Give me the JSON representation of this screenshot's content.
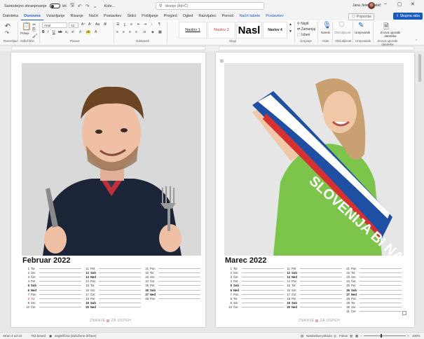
{
  "titlebar": {
    "autosave_label": "Samodejno shranjevanje",
    "autosave_state": "Izk",
    "doc_title": "Kole...",
    "search_placeholder": "Iskanje (Alt+Č)",
    "user_name": "Jana Jelenc Babič",
    "icons": [
      "save-icon",
      "undo-icon",
      "redo-icon"
    ]
  },
  "tabs": [
    "Datoteka",
    "Osnovno",
    "Vstavljanje",
    "Risanje",
    "Načrt",
    "Postavitev",
    "Sklici",
    "Pošiljanje",
    "Pregled",
    "Ogled",
    "Razvijalec",
    "Pomoč",
    "Načrt tabele",
    "Postavitev"
  ],
  "active_tab": "Osnovno",
  "contextual_tabs": [
    "Načrt tabele",
    "Postavitev"
  ],
  "comments_label": "Pripombe",
  "share_label": "Skupna raba",
  "ribbon": {
    "groups": [
      "Razveljavi",
      "Odložišče",
      "Pisava",
      "Odstavek",
      "Slogi",
      "Urejanje",
      "Glas",
      "Občutljivost",
      "Urejevalnik",
      "Znova uporabi datoteke"
    ],
    "paste_label": "Prilepi",
    "font_name": "Arial",
    "font_size": "12",
    "styles": [
      {
        "label": "Naslov 1",
        "color": "#1f3864"
      },
      {
        "label": "Naslov 2",
        "color": "#c0392b"
      },
      {
        "label": "Nasl",
        "color": "#000000"
      },
      {
        "label": "Naslov 4",
        "color": "#000000"
      }
    ],
    "editing": [
      "Najdi",
      "Zamenjaj",
      "Izberi"
    ],
    "dictate_label": "Nareki",
    "sensitivity_label": "Občutljivost",
    "editor_label": "Urejevalnik",
    "reuse_label": "Znova uporabi datoteke"
  },
  "pages": [
    {
      "month": "Februar 2022",
      "columns": [
        [
          [
            "1",
            "Tor"
          ],
          [
            "2",
            "Sre"
          ],
          [
            "3",
            "Čet"
          ],
          [
            "4",
            "Pet"
          ],
          [
            "5",
            "Sob"
          ],
          [
            "6",
            "Ned"
          ],
          [
            "7",
            "Pon"
          ],
          [
            "8",
            "Tor"
          ],
          [
            "9",
            "Sre"
          ],
          [
            "10",
            "Čet"
          ]
        ],
        [
          [
            "11",
            "Pet"
          ],
          [
            "12",
            "Sob"
          ],
          [
            "13",
            "Ned"
          ],
          [
            "14",
            "Pon"
          ],
          [
            "15",
            "Tor"
          ],
          [
            "16",
            "Sre"
          ],
          [
            "17",
            "Čet"
          ],
          [
            "18",
            "Pet"
          ],
          [
            "19",
            "Sob"
          ],
          [
            "20",
            "Ned"
          ]
        ],
        [
          [
            "21",
            "Pon"
          ],
          [
            "22",
            "Tor"
          ],
          [
            "23",
            "Sre"
          ],
          [
            "24",
            "Čet"
          ],
          [
            "25",
            "Pet"
          ],
          [
            "26",
            "Sob"
          ],
          [
            "27",
            "Ned"
          ],
          [
            "28",
            "Pon"
          ]
        ]
      ],
      "weekends": [
        "5",
        "6",
        "12",
        "13",
        "19",
        "20",
        "26",
        "27"
      ],
      "holidays": [
        "8"
      ]
    },
    {
      "month": "Marec 2022",
      "columns": [
        [
          [
            "1",
            "Tor"
          ],
          [
            "2",
            "Sre"
          ],
          [
            "3",
            "Čet"
          ],
          [
            "4",
            "Pet"
          ],
          [
            "5",
            "Sob"
          ],
          [
            "6",
            "Ned"
          ],
          [
            "7",
            "Pon"
          ],
          [
            "8",
            "Tor"
          ],
          [
            "9",
            "Sre"
          ],
          [
            "10",
            "Čet"
          ]
        ],
        [
          [
            "11",
            "Pet"
          ],
          [
            "12",
            "Sob"
          ],
          [
            "13",
            "Ned"
          ],
          [
            "14",
            "Pon"
          ],
          [
            "15",
            "Tor"
          ],
          [
            "16",
            "Sre"
          ],
          [
            "17",
            "Čet"
          ],
          [
            "18",
            "Pet"
          ],
          [
            "19",
            "Sob"
          ],
          [
            "20",
            "Ned"
          ]
        ],
        [
          [
            "21",
            "Pon"
          ],
          [
            "22",
            "Tor"
          ],
          [
            "23",
            "Sre"
          ],
          [
            "24",
            "Čet"
          ],
          [
            "25",
            "Pet"
          ],
          [
            "26",
            "Sob"
          ],
          [
            "27",
            "Ned"
          ],
          [
            "28",
            "Pon"
          ],
          [
            "29",
            "Tor"
          ],
          [
            "30",
            "Sre"
          ],
          [
            "31",
            "Čet"
          ]
        ]
      ],
      "weekends": [
        "5",
        "6",
        "12",
        "13",
        "19",
        "20",
        "26",
        "27"
      ],
      "holidays": []
    }
  ],
  "brand_left": "ZNANJE",
  "brand_right": "ZA USPEH",
  "scarf_text": "SLOVENIJA BI NAJBOLJŠA",
  "statusbar": {
    "page": "Stran 4 od 13",
    "words": "763 besed",
    "language": "angleščina (Združene države)",
    "accessibility": "Nastavitve prikaza",
    "focus": "Fokus",
    "zoom": "100%"
  },
  "colors": {
    "accent": "#185abd",
    "holiday": "#d03a3a",
    "brand_pink": "#e8a6c8",
    "jersey_navy": "#1c2438",
    "jersey_green": "#7cc44a"
  }
}
